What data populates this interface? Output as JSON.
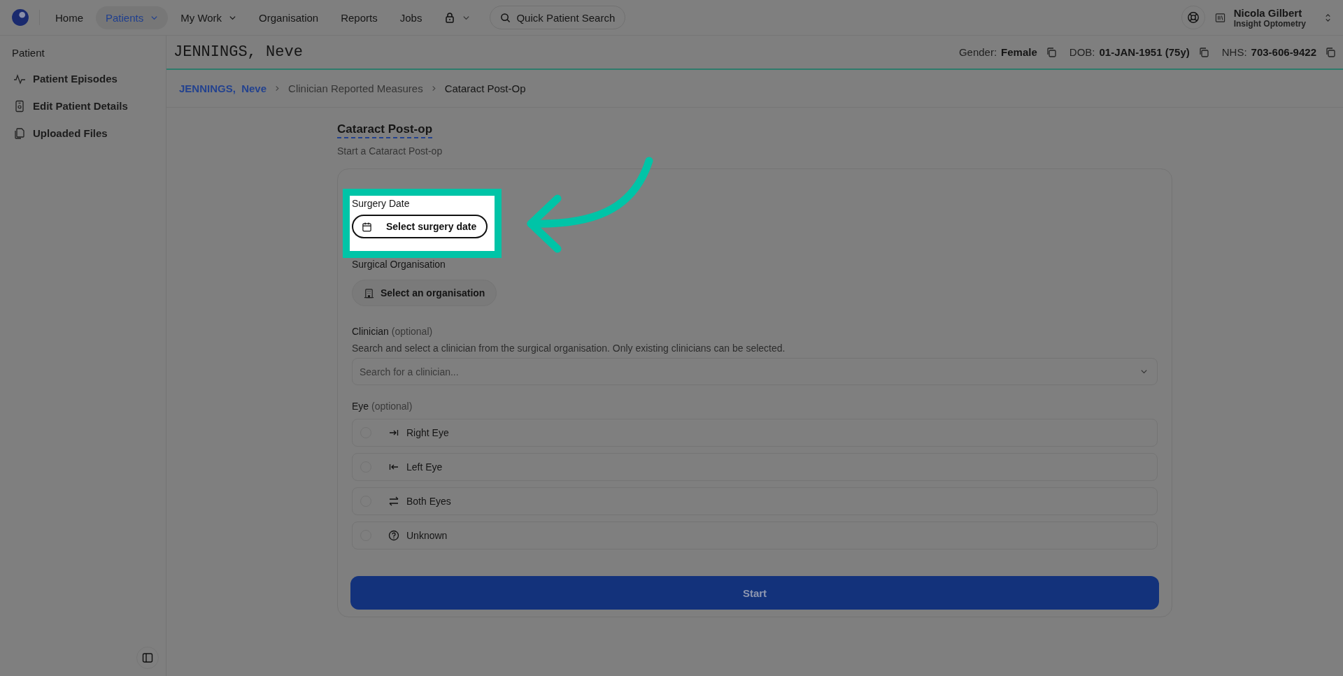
{
  "nav": {
    "items": [
      {
        "label": "Home",
        "selected": false,
        "has_caret": false
      },
      {
        "label": "Patients",
        "selected": true,
        "has_caret": true
      },
      {
        "label": "My Work",
        "selected": false,
        "has_caret": true
      },
      {
        "label": "Organisation",
        "selected": false,
        "has_caret": false
      },
      {
        "label": "Reports",
        "selected": false,
        "has_caret": false
      },
      {
        "label": "Jobs",
        "selected": false,
        "has_caret": false
      }
    ],
    "search": "Quick Patient Search",
    "user": {
      "name": "Nicola Gilbert",
      "org": "Insight Optometry"
    }
  },
  "sidebar": {
    "heading": "Patient",
    "items": [
      {
        "label": "Patient Episodes",
        "kind": "pulse"
      },
      {
        "label": "Edit Patient Details",
        "kind": "badge"
      },
      {
        "label": "Uploaded Files",
        "kind": "files"
      }
    ]
  },
  "patient": {
    "name": "JENNINGS, Neve",
    "fields": [
      {
        "label": "Gender:",
        "value": "Female"
      },
      {
        "label": "DOB:",
        "value": "01-JAN-1951 (75y)"
      },
      {
        "label": "NHS:",
        "value": "703-606-9422"
      }
    ]
  },
  "breadcrumb": [
    {
      "label": "JENNINGS,  Neve",
      "kind": "link"
    },
    {
      "label": "Clinician Reported Measures",
      "kind": "crumb"
    },
    {
      "label": "Cataract Post-Op",
      "kind": "current"
    }
  ],
  "form": {
    "title": "Cataract Post-op",
    "subtitle": "Start a Cataract Post-op",
    "surgery_date": {
      "label": "Surgery Date",
      "button": "Select surgery date",
      "highlighted": true
    },
    "organisation": {
      "label": "Surgical Organisation",
      "button": "Select an organisation"
    },
    "clinician": {
      "label": "Clinician",
      "optional": "(optional)",
      "help": "Search and select a clinician from the surgical organisation. Only existing clinicians can be selected.",
      "placeholder": "Search for a clinician..."
    },
    "eye": {
      "label": "Eye",
      "optional": "(optional)",
      "options": [
        {
          "label": "Right Eye",
          "kind": "right",
          "selected": false
        },
        {
          "label": "Left Eye",
          "kind": "left",
          "selected": false
        },
        {
          "label": "Both Eyes",
          "kind": "both",
          "selected": false
        },
        {
          "label": "Unknown",
          "kind": "unknown",
          "selected": false
        }
      ]
    },
    "submit": "Start"
  }
}
